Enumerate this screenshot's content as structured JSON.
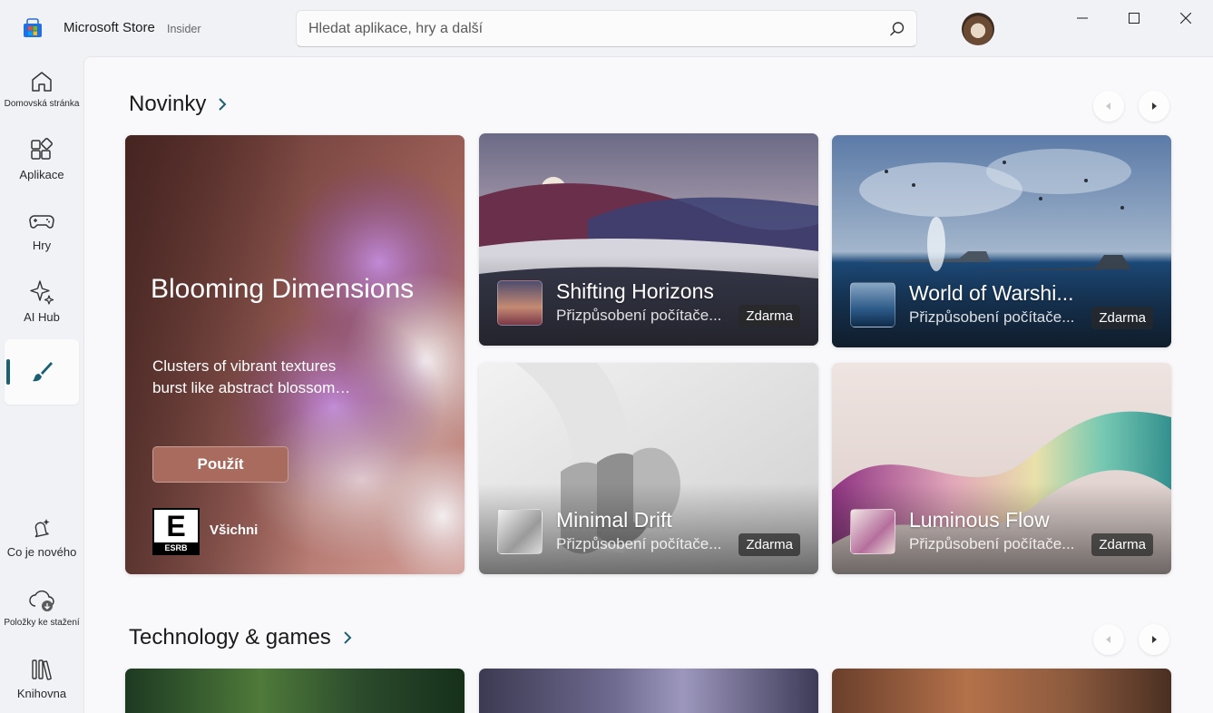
{
  "window": {
    "app_name": "Microsoft Store",
    "badge": "Insider",
    "search_placeholder": "Hledat aplikace, hry a další"
  },
  "sidebar": {
    "top_items": [
      {
        "label": "Domovská stránka",
        "icon": "home-icon"
      },
      {
        "label": "Aplikace",
        "icon": "apps-icon"
      },
      {
        "label": "Hry",
        "icon": "gamepad-icon"
      },
      {
        "label": "AI Hub",
        "icon": "sparkle-icon"
      },
      {
        "label": "",
        "icon": "paintbrush-icon",
        "active": true
      }
    ],
    "bottom_items": [
      {
        "label": "Co je nového",
        "icon": "whats-new-icon"
      },
      {
        "label": "Položky ke stažení",
        "icon": "cloud-download-icon"
      },
      {
        "label": "Knihovna",
        "icon": "library-icon"
      }
    ]
  },
  "sections": [
    {
      "title": "Novinky"
    },
    {
      "title": "Technology & games"
    }
  ],
  "hero": {
    "title": "Blooming Dimensions",
    "description": "Clusters of vibrant textures burst like abstract blossom…",
    "button": "Použít",
    "rating_label": "Všichni",
    "esrb_letter": "E",
    "esrb_text": "ESRB"
  },
  "cards": [
    {
      "title": "Shifting Horizons",
      "subtitle": "Přizpůsobení počítače...",
      "price": "Zdarma"
    },
    {
      "title": "World of Warshi...",
      "subtitle": "Přizpůsobení počítače...",
      "price": "Zdarma"
    },
    {
      "title": "Minimal Drift",
      "subtitle": "Přizpůsobení počítače...",
      "price": "Zdarma"
    },
    {
      "title": "Luminous Flow",
      "subtitle": "Přizpůsobení počítače...",
      "price": "Zdarma"
    }
  ],
  "colors": {
    "accent": "#1b5f73",
    "hero_button": "#a86b5d",
    "background": "#f0f2f6"
  }
}
